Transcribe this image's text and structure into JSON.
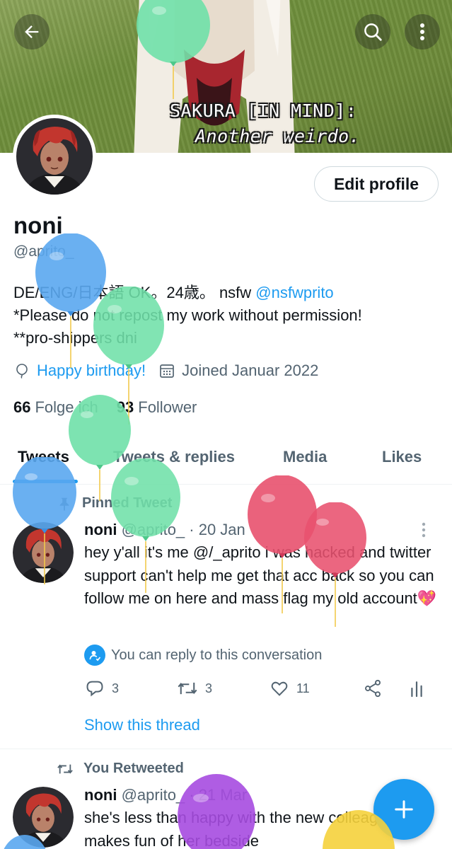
{
  "banner": {
    "subtitle_line1": "SAKURA [IN MIND]:",
    "subtitle_line2": "Another weirdo."
  },
  "header": {
    "back_icon": "arrow-left-icon",
    "search_icon": "search-icon",
    "more_icon": "more-vertical-icon"
  },
  "profile": {
    "edit_label": "Edit profile",
    "display_name": "noni",
    "handle": "@aprito_",
    "bio_line1_text": "DE/ENG/日本語 OK。24歳。 nsfw ",
    "bio_line1_mention": "@nsfwprito",
    "bio_line2": "*Please do not repost my work without permission!",
    "bio_line3": "**pro-shippers dni",
    "birthday": "Happy birthday!",
    "joined": "Joined Januar 2022",
    "following_count": "66",
    "following_label": "Folge ich",
    "followers_count": "93",
    "followers_label": "Follower"
  },
  "tabs": [
    "Tweets",
    "Tweets & replies",
    "Media",
    "Likes"
  ],
  "tweet1": {
    "context": "Pinned Tweet",
    "name": "noni",
    "handle_date": "@aprito_ · 20 Jan",
    "text": "hey y'all it's me @/_aprito i was hacked and twitter support can't help me get that acc back so you can follow me on here and mass flag my old account💖",
    "reply_note": "You can reply to this conversation",
    "replies": "3",
    "retweets": "3",
    "likes": "11",
    "show_thread": "Show this thread"
  },
  "tweet2": {
    "context": "You Retweeted",
    "name": "noni",
    "handle_date": "@aprito_ · 21 Mar",
    "text": "she's less than happy with the new colleague who makes fun of her bedside"
  },
  "colors": {
    "accent": "#1d9bf0",
    "text": "#0f1419",
    "muted": "#536471",
    "balloon_green": "#6fe0a8",
    "balloon_blue": "#5aa7f0",
    "balloon_red": "#e8516e",
    "balloon_purple": "#a64be0",
    "balloon_yellow": "#f5d23c"
  }
}
